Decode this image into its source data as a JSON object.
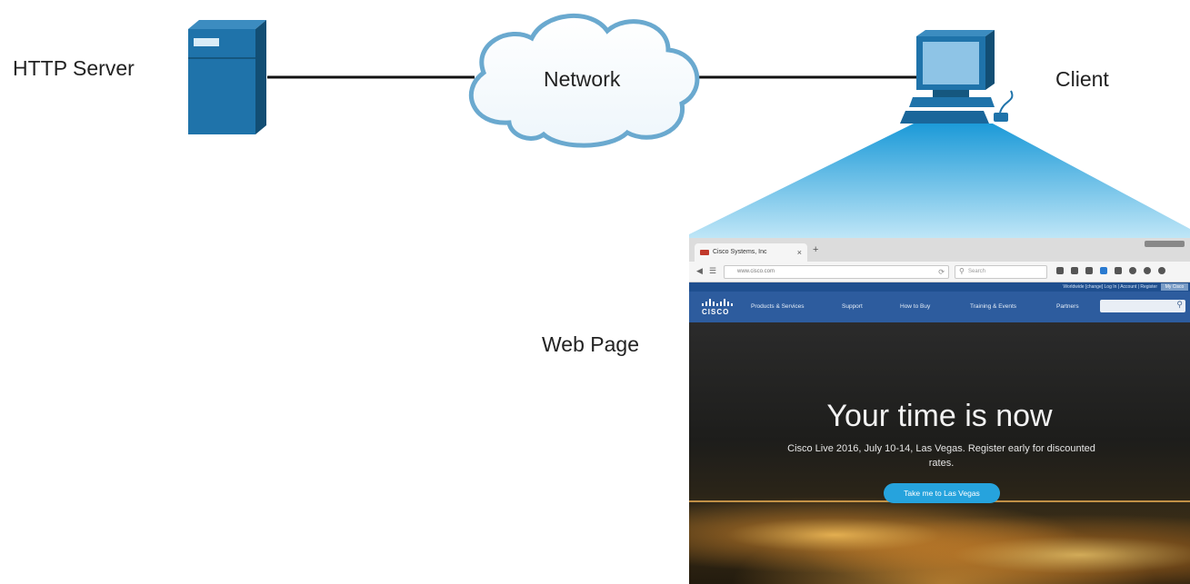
{
  "labels": {
    "server": "HTTP Server",
    "network": "Network",
    "client": "Client",
    "webpage": "Web Page"
  },
  "colors": {
    "device_blue": "#1f73aa",
    "device_blue_dark": "#15577f",
    "cloud_stroke": "#6aa9cf",
    "beam_top": "#1c9ad8",
    "beam_bottom": "#bfe6f7",
    "link_line": "#111111"
  },
  "browser": {
    "tab_title": "Cisco Systems, Inc",
    "tab_close": "×",
    "new_tab": "+",
    "url": "www.cisco.com",
    "search_placeholder": "Search",
    "top_links": "Worldwide [change]   Log In  |  Account  |  Register",
    "my_cisco": "My Cisco",
    "logo_text": "CISCO",
    "nav": [
      "Products & Services",
      "Support",
      "How to Buy",
      "Training & Events",
      "Partners"
    ],
    "hero_title": "Your time is now",
    "hero_subtitle": "Cisco Live 2016, July 10-14, Las Vegas. Register early for discounted rates.",
    "hero_button": "Take me to Las Vegas"
  }
}
